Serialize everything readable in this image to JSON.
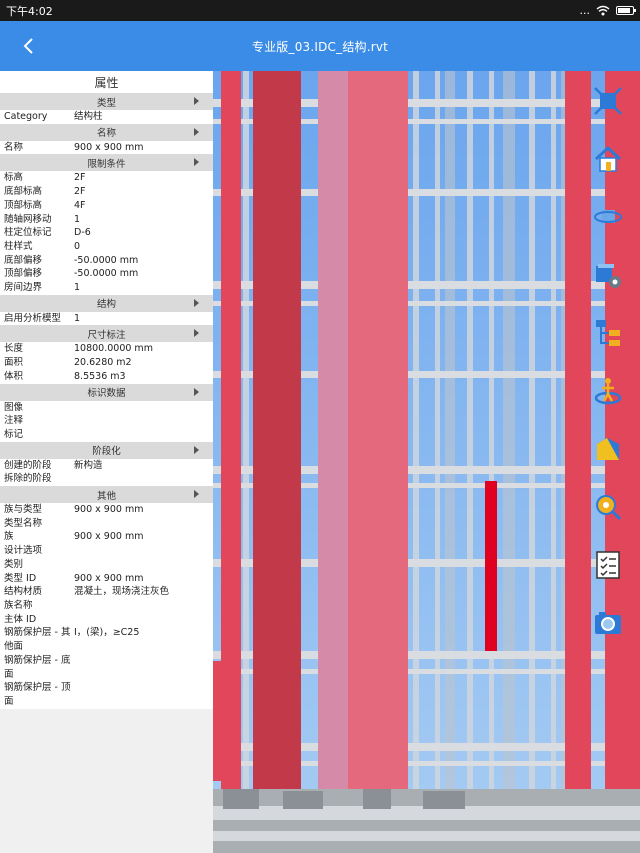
{
  "status": {
    "time": "下午4:02",
    "dots": "..."
  },
  "appbar": {
    "title": "专业版_03.IDC_结构.rvt"
  },
  "panel": {
    "title": "属性",
    "sections": [
      {
        "header": "类型",
        "rows": [
          {
            "k": "Category",
            "v": "结构柱"
          }
        ]
      },
      {
        "header": "名称",
        "rows": [
          {
            "k": "名称",
            "v": "900 x 900 mm"
          }
        ]
      },
      {
        "header": "限制条件",
        "rows": [
          {
            "k": "标高",
            "v": "2F"
          },
          {
            "k": "底部标高",
            "v": "2F"
          },
          {
            "k": "顶部标高",
            "v": "4F"
          },
          {
            "k": "随轴网移动",
            "v": "1"
          },
          {
            "k": "柱定位标记",
            "v": "D-6"
          },
          {
            "k": "柱样式",
            "v": "0"
          },
          {
            "k": "底部偏移",
            "v": "-50.0000 mm"
          },
          {
            "k": "顶部偏移",
            "v": "-50.0000 mm"
          },
          {
            "k": "房间边界",
            "v": "1"
          }
        ]
      },
      {
        "header": "结构",
        "rows": [
          {
            "k": "启用分析模型",
            "v": "1"
          }
        ]
      },
      {
        "header": "尺寸标注",
        "rows": [
          {
            "k": "长度",
            "v": "10800.0000 mm"
          },
          {
            "k": "面积",
            "v": "20.6280 m2"
          },
          {
            "k": "体积",
            "v": "8.5536 m3"
          }
        ]
      },
      {
        "header": "标识数据",
        "rows": [
          {
            "k": "图像",
            "v": ""
          },
          {
            "k": "注释",
            "v": ""
          },
          {
            "k": "标记",
            "v": ""
          }
        ]
      },
      {
        "header": "阶段化",
        "rows": [
          {
            "k": "创建的阶段",
            "v": "新构造"
          },
          {
            "k": "拆除的阶段",
            "v": ""
          }
        ]
      },
      {
        "header": "其他",
        "rows": [
          {
            "k": "族与类型",
            "v": "900 x 900 mm"
          },
          {
            "k": "类型名称",
            "v": ""
          },
          {
            "k": "族",
            "v": "900 x 900 mm"
          },
          {
            "k": "设计选项",
            "v": ""
          },
          {
            "k": "类别",
            "v": ""
          },
          {
            "k": "类型 ID",
            "v": "900 x 900 mm"
          },
          {
            "k": "结构材质",
            "v": "混凝土，现场浇注灰色"
          },
          {
            "k": "族名称",
            "v": ""
          },
          {
            "k": "主体 ID",
            "v": ""
          },
          {
            "k": "钢筋保护层 - 其他面",
            "v": "I，(梁)，≥C25"
          },
          {
            "k": "钢筋保护层 - 底面",
            "v": ""
          },
          {
            "k": "钢筋保护层 - 顶面",
            "v": ""
          }
        ]
      }
    ]
  },
  "toolbar": {
    "tools": [
      {
        "name": "fit-view-icon"
      },
      {
        "name": "home-icon"
      },
      {
        "name": "orbit-icon"
      },
      {
        "name": "view-settings-icon"
      },
      {
        "name": "model-tree-icon"
      },
      {
        "name": "walk-mode-icon"
      },
      {
        "name": "section-box-icon"
      },
      {
        "name": "measure-icon"
      },
      {
        "name": "checklist-icon"
      },
      {
        "name": "screenshot-icon"
      }
    ]
  },
  "colors": {
    "appbar": "#3b8ce6",
    "panel": "#f0f0f0",
    "category": "#dadada",
    "column": "#e2465a",
    "glass": "#7fb2ee"
  }
}
